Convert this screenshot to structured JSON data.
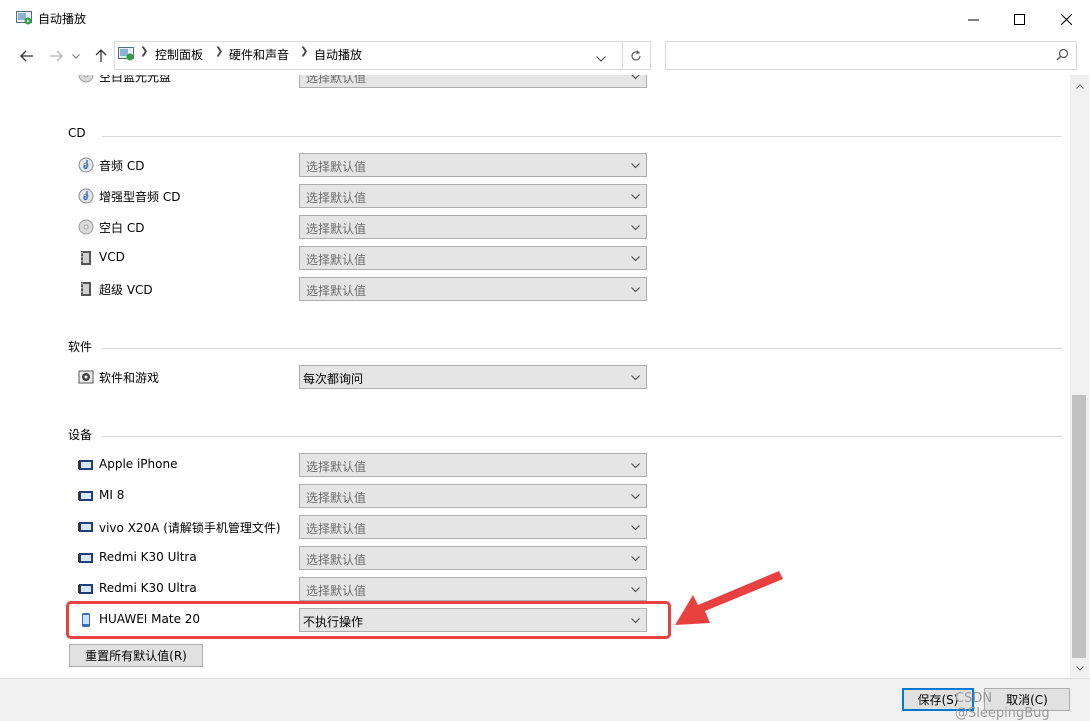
{
  "window": {
    "title": "自动播放",
    "controls": [
      "minimize",
      "maximize",
      "close"
    ]
  },
  "address": {
    "breadcrumbs": [
      "控制面板",
      "硬件和声音",
      "自动播放"
    ],
    "search_placeholder": ""
  },
  "partial_top": {
    "label": "空白蓝光光盘",
    "value": "选择默认值"
  },
  "sections": {
    "cd": {
      "title": "CD",
      "rows": [
        {
          "label": "音频 CD",
          "value": "选择默认值",
          "icon": "audio-cd-icon"
        },
        {
          "label": "增强型音频 CD",
          "value": "选择默认值",
          "icon": "audio-cd-icon"
        },
        {
          "label": "空白 CD",
          "value": "选择默认值",
          "icon": "blank-cd-icon"
        },
        {
          "label": "VCD",
          "value": "选择默认值",
          "icon": "film-icon"
        },
        {
          "label": "超级 VCD",
          "value": "选择默认值",
          "icon": "film-icon"
        }
      ]
    },
    "software": {
      "title": "软件",
      "rows": [
        {
          "label": "软件和游戏",
          "value": "每次都询问",
          "icon": "software-disc-icon"
        }
      ]
    },
    "devices": {
      "title": "设备",
      "rows": [
        {
          "label": "Apple iPhone",
          "value": "选择默认值",
          "icon": "device-icon"
        },
        {
          "label": "MI 8",
          "value": "选择默认值",
          "icon": "device-icon"
        },
        {
          "label": "vivo X20A (请解锁手机管理文件)",
          "value": "选择默认值",
          "icon": "device-icon"
        },
        {
          "label": "Redmi K30 Ultra",
          "value": "选择默认值",
          "icon": "device-icon"
        },
        {
          "label": "Redmi K30 Ultra",
          "value": "选择默认值",
          "icon": "device-icon"
        },
        {
          "label": "HUAWEI Mate 20",
          "value": "不执行操作",
          "icon": "phone-icon"
        }
      ]
    }
  },
  "reset_button": "重置所有默认值(R)",
  "footer": {
    "save": "保存(S)",
    "cancel": "取消(C)"
  },
  "watermark": "CSDN @SleepingBug",
  "colors": {
    "highlight": "#e94040",
    "arrow": "#e94040"
  }
}
